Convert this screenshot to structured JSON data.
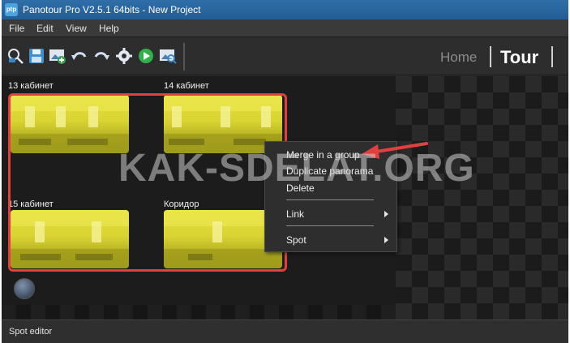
{
  "window": {
    "title": "Panotour Pro V2.5.1 64bits - New Project",
    "app_icon_text": "ptp"
  },
  "menu": [
    "File",
    "Edit",
    "View",
    "Help"
  ],
  "toolbar": {
    "icons": [
      "find-panorama-icon",
      "save-icon",
      "add-panorama-icon",
      "undo-icon",
      "redo-icon",
      "settings-gear-icon",
      "play-icon",
      "preview-icon"
    ],
    "nav": {
      "home": "Home",
      "tour": "Tour"
    }
  },
  "panoramas": [
    {
      "label": "13 кабинет"
    },
    {
      "label": "14 кабинет"
    },
    {
      "label": "15 кабинет"
    },
    {
      "label": "Коридор"
    }
  ],
  "context_menu": {
    "items": [
      "Merge in a group",
      "Duplicate panorama",
      "Delete",
      "Link",
      "Spot"
    ]
  },
  "watermark": "KAK-SDELAT.ORG",
  "statusbar": {
    "label": "Spot editor"
  },
  "colors": {
    "selection_border": "#e2403f",
    "annotation_arrow": "#e2403f",
    "thumbnail_tint": "#e3df39"
  }
}
